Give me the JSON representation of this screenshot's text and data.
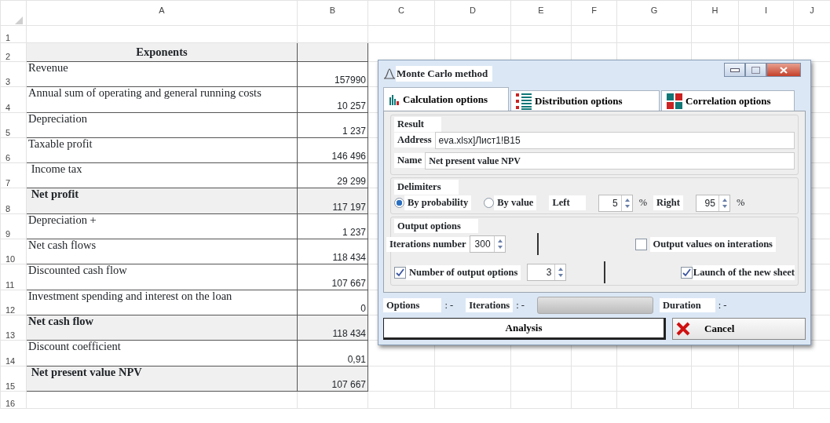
{
  "sheet": {
    "columns": [
      "A",
      "B",
      "C",
      "D",
      "E",
      "F",
      "G",
      "H",
      "I",
      "J"
    ],
    "rows": [
      {
        "number": "1",
        "kind": "empty"
      },
      {
        "number": "2",
        "kind": "heading",
        "label": "Exponents"
      },
      {
        "number": "3",
        "kind": "item",
        "label": "Revenue",
        "value": "157990"
      },
      {
        "number": "4",
        "kind": "item",
        "label": "Annual sum of operating and general running costs",
        "value": "10 257"
      },
      {
        "number": "5",
        "kind": "item",
        "label": "Depreciation",
        "value": "1 237"
      },
      {
        "number": "6",
        "kind": "item",
        "label": "Taxable profit",
        "value": "146 496"
      },
      {
        "number": "7",
        "kind": "item",
        "label": " Income tax",
        "value": "29 299"
      },
      {
        "number": "8",
        "kind": "total",
        "label": " Net profit",
        "value": "117 197"
      },
      {
        "number": "9",
        "kind": "item",
        "label": "Depreciation +",
        "value": "1 237"
      },
      {
        "number": "10",
        "kind": "item",
        "label": "Net cash flows",
        "value": "118 434"
      },
      {
        "number": "11",
        "kind": "item",
        "label": "Discounted cash flow",
        "value": "107 667"
      },
      {
        "number": "12",
        "kind": "item",
        "label": "Investment spending and interest on the loan",
        "value": "0"
      },
      {
        "number": "13",
        "kind": "total",
        "label": "Net cash flow",
        "value": "118 434"
      },
      {
        "number": "14",
        "kind": "item",
        "label": "Discount coefficient",
        "value": "0,91"
      },
      {
        "number": "15",
        "kind": "total",
        "label": " Net present value NPV",
        "value": "107 667"
      },
      {
        "number": "16",
        "kind": "empty"
      }
    ]
  },
  "dialog": {
    "title": "Monte Carlo method",
    "tabs": [
      {
        "label": "Calculation options",
        "selected": true,
        "kind": "bars"
      },
      {
        "label": "Distribution options",
        "selected": false,
        "kind": "list"
      },
      {
        "label": "Correlation options",
        "selected": false,
        "kind": "grid"
      }
    ],
    "result": {
      "title": "Result",
      "address_label": "Address",
      "address_value": "eva.xlsx]Лист1!B15",
      "name_label": "Name",
      "name_value": "Net present value NPV"
    },
    "delimiters": {
      "title": "Delimiters",
      "modes": [
        {
          "label": "By probability",
          "selected": true
        },
        {
          "label": "By value",
          "selected": false
        }
      ],
      "left_label": "Left",
      "left_value": "5",
      "left_unit": "%",
      "right_label": "Right",
      "right_value": "95",
      "right_unit": "%"
    },
    "output": {
      "title": "Output options",
      "iterations_label": "Iterations number",
      "iterations_value": "300",
      "output_values": {
        "label": "Output values on interations",
        "checked": false
      },
      "number_of_outputs": {
        "label": "Number of output options",
        "checked": true,
        "value": "3"
      },
      "new_sheet": {
        "label": "Launch of the new sheet",
        "checked": true
      }
    },
    "status": {
      "options_label": "Options",
      "options_value": ": -",
      "iterations_label": "Iterations",
      "iterations_value": ": -",
      "progress": {
        "level": 0
      },
      "duration_label": "Duration",
      "duration_value": ": -"
    },
    "buttons": [
      {
        "label": "Analysis",
        "kind": "default"
      },
      {
        "label": "Cancel",
        "kind": "cancel"
      }
    ]
  }
}
